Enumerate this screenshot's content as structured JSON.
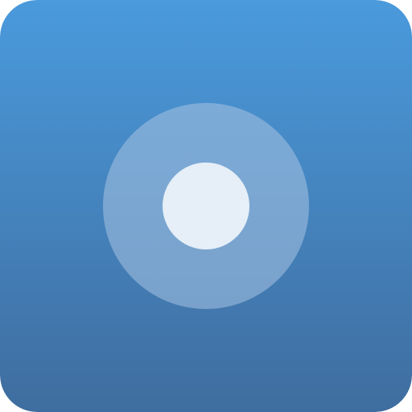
{
  "app_icon": {
    "icon_name": "record-button-icon",
    "colors": {
      "gradient_top": "#4A9ADC",
      "gradient_bottom": "#3F6D9F",
      "outer_ring": "#A7C3E2",
      "outer_ring_opacity": 0.55,
      "inner_dot": "#E6EEF7"
    }
  }
}
